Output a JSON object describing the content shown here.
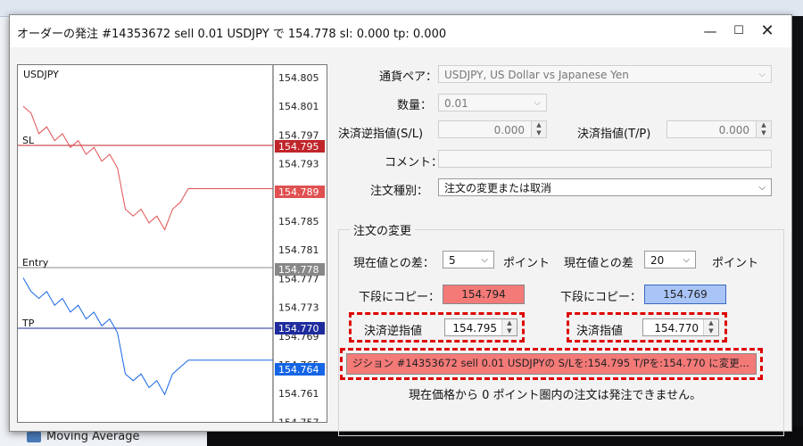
{
  "dialog": {
    "title": "オーダーの発注 #14353672 sell 0.01 USDJPY で 154.778 sl: 0.000 tp: 0.000",
    "minimize_icon": "minimize-icon",
    "maximize_icon": "maximize-icon",
    "close_icon": "close-icon"
  },
  "background": {
    "moving_average_label": "Moving Average"
  },
  "chart": {
    "symbol": "USDJPY",
    "prices": [
      "154.805",
      "154.801",
      "154.797",
      "154.793",
      "154.789",
      "154.785",
      "154.781",
      "154.777",
      "154.773",
      "154.769",
      "154.765",
      "154.761",
      "154.757"
    ],
    "sl_label": "SL",
    "sl_tag": "154.795",
    "bid_tag": "154.789",
    "entry_label": "Entry",
    "entry_tag": "154.778",
    "tp_label": "TP",
    "tp_tag": "154.770",
    "ask_tag": "154.764",
    "colors": {
      "bid": "#e05050",
      "ask": "#1565e6",
      "sl": "#c0252a",
      "tp": "#1e2c9e",
      "entry": "#888888"
    }
  },
  "chart_data": {
    "type": "line",
    "title": "USDJPY",
    "ylim": [
      154.755,
      154.807
    ],
    "series": [
      {
        "values": [
          154.801,
          154.8,
          154.797,
          154.798,
          154.796,
          154.797,
          154.795,
          154.796,
          154.794,
          154.795,
          154.793,
          154.794,
          154.792,
          154.786,
          154.785,
          154.786,
          154.784,
          154.785,
          154.783,
          154.786,
          154.787,
          154.789
        ]
      },
      {
        "values": [
          154.776,
          154.774,
          154.773,
          154.774,
          154.772,
          154.773,
          154.771,
          154.772,
          154.77,
          154.771,
          154.769,
          154.77,
          154.768,
          154.762,
          154.761,
          154.762,
          154.76,
          154.761,
          154.759,
          154.762,
          154.763,
          154.764
        ]
      }
    ]
  },
  "form": {
    "currency_pair_label": "通貨ペア：",
    "currency_pair_value": "USDJPY, US Dollar vs Japanese Yen",
    "volume_label": "数量：",
    "volume_value": "0.01",
    "sl_label": "決済逆指値(S/L)",
    "sl_value": "0.000",
    "tp_label": "決済指値(T/P)",
    "tp_value": "0.000",
    "comment_label": "コメント：",
    "comment_value": "",
    "order_type_label": "注文種別：",
    "order_type_value": "注文の変更または取消",
    "group_title": "注文の変更",
    "diff_label_left": "現在値との差：",
    "diff_value_left": "5",
    "points_left": "ポイント",
    "diff_label_right": "現在値との差",
    "diff_value_right": "20",
    "points_right": "ポイント",
    "copy_label_left": "下段にコピー：",
    "copy_value_left": "154.794",
    "copy_label_right": "下段にコピー：",
    "copy_value_right": "154.769",
    "new_sl_label": "決済逆指値",
    "new_sl_value": "154.795",
    "new_tp_label": "決済指値",
    "new_tp_value": "154.770",
    "modify_button": "ジション #14353672 sell 0.01 USDJPYの S/Lを:154.795 T/Pを:154.770 に変更...",
    "notice": "現在価格から 0 ポイント圏内の注文は発注できません。"
  }
}
